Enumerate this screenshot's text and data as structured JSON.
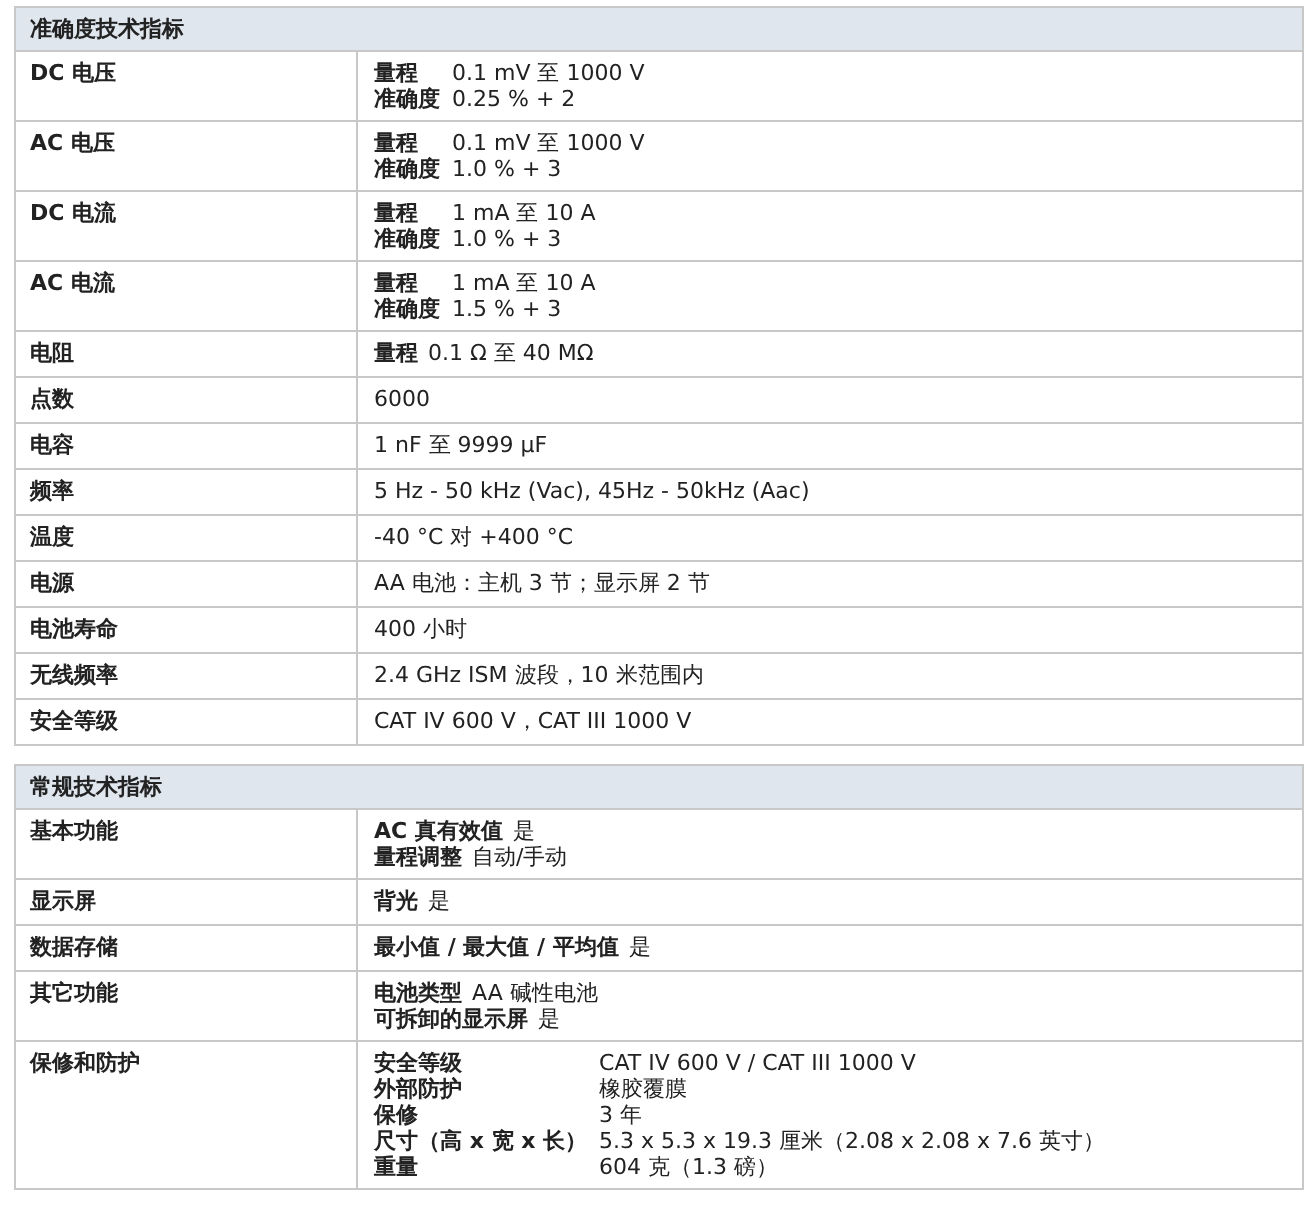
{
  "sections": [
    {
      "title": "准确度技术指标",
      "rows": [
        {
          "label": "DC 电压",
          "kind": "aligned",
          "lines": [
            {
              "key": "量程",
              "value": "0.1 mV 至 1000 V"
            },
            {
              "key": "准确度",
              "value": "0.25 % + 2"
            }
          ]
        },
        {
          "label": "AC 电压",
          "kind": "aligned",
          "lines": [
            {
              "key": "量程",
              "value": "0.1 mV 至 1000 V"
            },
            {
              "key": "准确度",
              "value": "1.0 % + 3"
            }
          ]
        },
        {
          "label": "DC 电流",
          "kind": "aligned",
          "lines": [
            {
              "key": "量程",
              "value": "1 mA 至 10 A"
            },
            {
              "key": "准确度",
              "value": "1.0 % + 3"
            }
          ]
        },
        {
          "label": "AC 电流",
          "kind": "aligned",
          "lines": [
            {
              "key": "量程",
              "value": "1 mA 至 10 A"
            },
            {
              "key": "准确度",
              "value": "1.5 % + 3"
            }
          ]
        },
        {
          "label": "电阻",
          "kind": "inline",
          "lines": [
            {
              "key": "量程",
              "value": "0.1 Ω 至 40 MΩ"
            }
          ]
        },
        {
          "label": "点数",
          "kind": "inline",
          "lines": [
            {
              "value": "6000"
            }
          ]
        },
        {
          "label": "电容",
          "kind": "inline",
          "lines": [
            {
              "value": "1 nF 至 9999 μF"
            }
          ]
        },
        {
          "label": "频率",
          "kind": "inline",
          "lines": [
            {
              "value": "5 Hz - 50 kHz (Vac), 45Hz - 50kHz (Aac)"
            }
          ]
        },
        {
          "label": "温度",
          "kind": "inline",
          "lines": [
            {
              "value": "-40 °C 对 +400 °C"
            }
          ]
        },
        {
          "label": "电源",
          "kind": "inline",
          "lines": [
            {
              "value": "AA 电池：主机 3 节；显示屏 2 节"
            }
          ]
        },
        {
          "label": "电池寿命",
          "kind": "inline",
          "lines": [
            {
              "value": "400 小时"
            }
          ]
        },
        {
          "label": "无线频率",
          "kind": "inline",
          "lines": [
            {
              "value": "2.4 GHz ISM 波段，10 米范围内"
            }
          ]
        },
        {
          "label": "安全等级",
          "kind": "inline",
          "lines": [
            {
              "value": "CAT IV 600 V，CAT III 1000 V"
            }
          ]
        }
      ]
    },
    {
      "title": "常规技术指标",
      "rows": [
        {
          "label": "基本功能",
          "kind": "inline",
          "lines": [
            {
              "key": "AC 真有效值",
              "value": "是"
            },
            {
              "key": "量程调整",
              "value": "自动/手动"
            }
          ]
        },
        {
          "label": "显示屏",
          "kind": "inline",
          "lines": [
            {
              "key": "背光",
              "value": "是"
            }
          ]
        },
        {
          "label": "数据存储",
          "kind": "inline",
          "lines": [
            {
              "key": "最小值 / 最大值 / 平均值",
              "value": "是"
            }
          ]
        },
        {
          "label": "其它功能",
          "kind": "inline",
          "lines": [
            {
              "key": "电池类型",
              "value": "AA 碱性电池"
            },
            {
              "key": "可拆卸的显示屏",
              "value": "是"
            }
          ]
        },
        {
          "label": "保修和防护",
          "kind": "aligned",
          "lines": [
            {
              "key": "安全等级",
              "value": "CAT IV 600 V / CAT III 1000 V"
            },
            {
              "key": "外部防护",
              "value": "橡胶覆膜"
            },
            {
              "key": "保修",
              "value": "3 年"
            },
            {
              "key": "尺寸（高 x 宽 x 长）",
              "value": "5.3 x 5.3 x 19.3 厘米（2.08 x 2.08 x 7.6 英寸）"
            },
            {
              "key": "重量",
              "value": "604 克（1.3 磅）"
            }
          ]
        }
      ]
    }
  ]
}
